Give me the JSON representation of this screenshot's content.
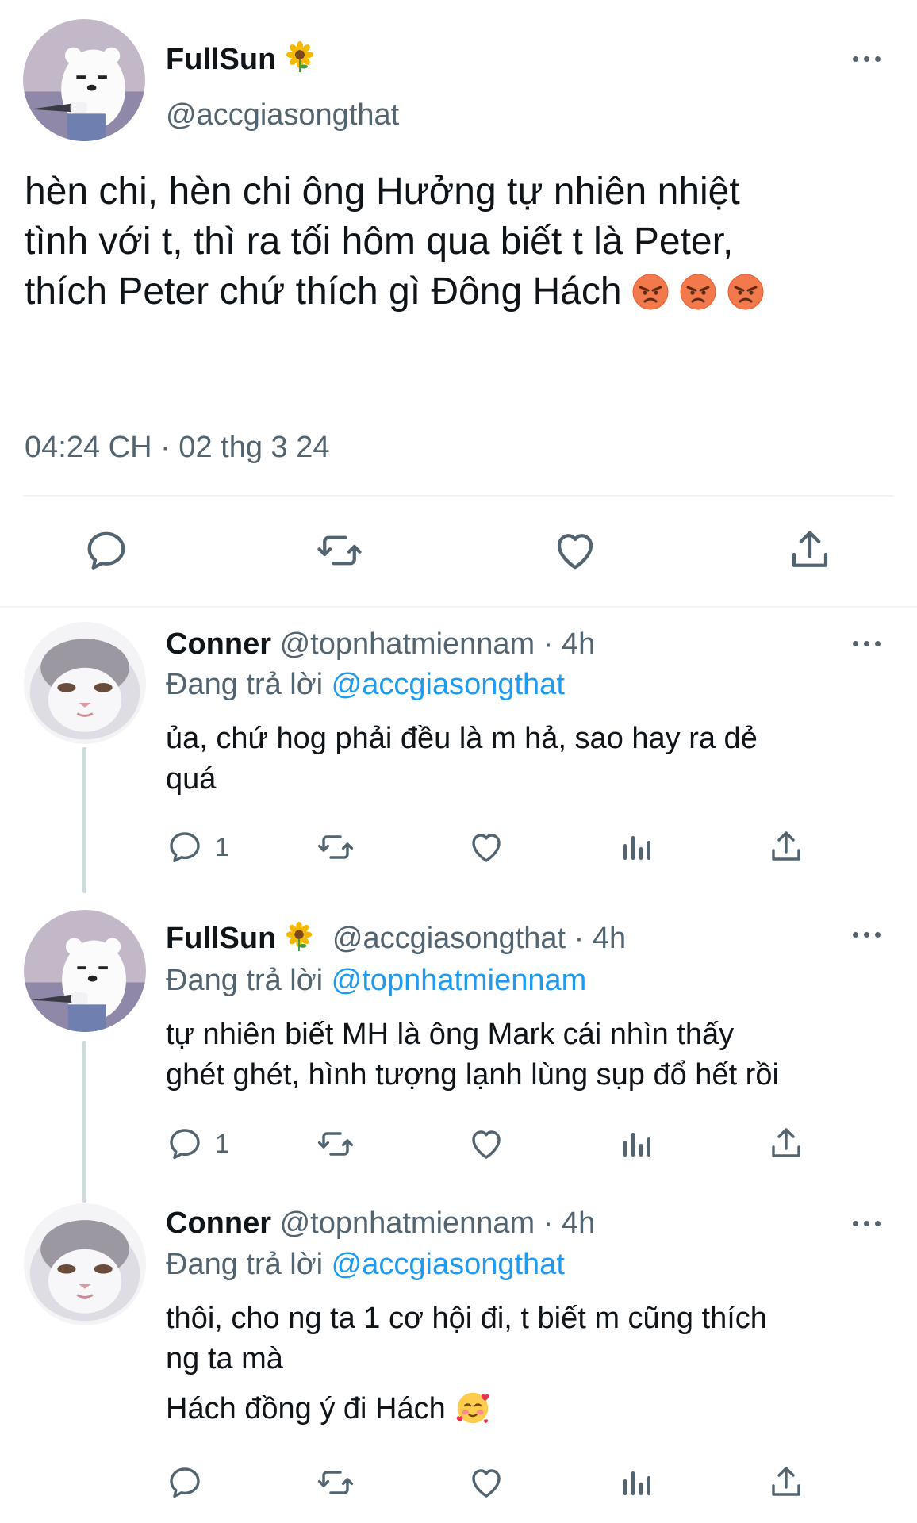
{
  "main_tweet": {
    "display_name": "FullSun",
    "handle": "@accgiasongthat",
    "text_line1": "hèn chi, hèn chi ông Hưởng tự nhiên nhiệt",
    "text_line2": "tình với t, thì ra tối hôm qua biết t là Peter,",
    "text_line3": "thích Peter chứ thích gì Đông Hách",
    "timestamp": "04:24 CH · 02 thg 3 24",
    "icons": [
      "reply-icon",
      "retweet-icon",
      "like-icon",
      "share-icon"
    ]
  },
  "replies": [
    {
      "display_name": "Conner",
      "handle": "@topnhatmiennam",
      "time": "· 4h",
      "replying_prefix": "Đang trả lời",
      "replying_to": "@accgiasongthat",
      "line1": "ủa, chứ hog phải đều là m hả, sao hay ra dẻ",
      "line2": "quá",
      "line3": "",
      "reply_count": "1"
    },
    {
      "display_name": "FullSun",
      "handle": "@accgiasongthat",
      "time": "· 4h",
      "replying_prefix": "Đang trả lời",
      "replying_to": "@topnhatmiennam",
      "line1": "tự nhiên biết MH là ông Mark cái nhìn thấy",
      "line2": "ghét ghét, hình tượng lạnh lùng sụp đổ hết rồi",
      "line3": "",
      "reply_count": "1"
    },
    {
      "display_name": "Conner",
      "handle": "@topnhatmiennam",
      "time": "· 4h",
      "replying_prefix": "Đang trả lời",
      "replying_to": "@accgiasongthat",
      "line1": "thôi, cho ng ta 1 cơ hội đi, t biết m cũng thích",
      "line2": "ng ta mà",
      "line3": "Hách đồng ý đi Hách",
      "reply_count": ""
    }
  ],
  "colors": {
    "text": "#0f1419",
    "muted": "#536471",
    "link": "#1d9bf0",
    "divider": "#eff3f4"
  }
}
